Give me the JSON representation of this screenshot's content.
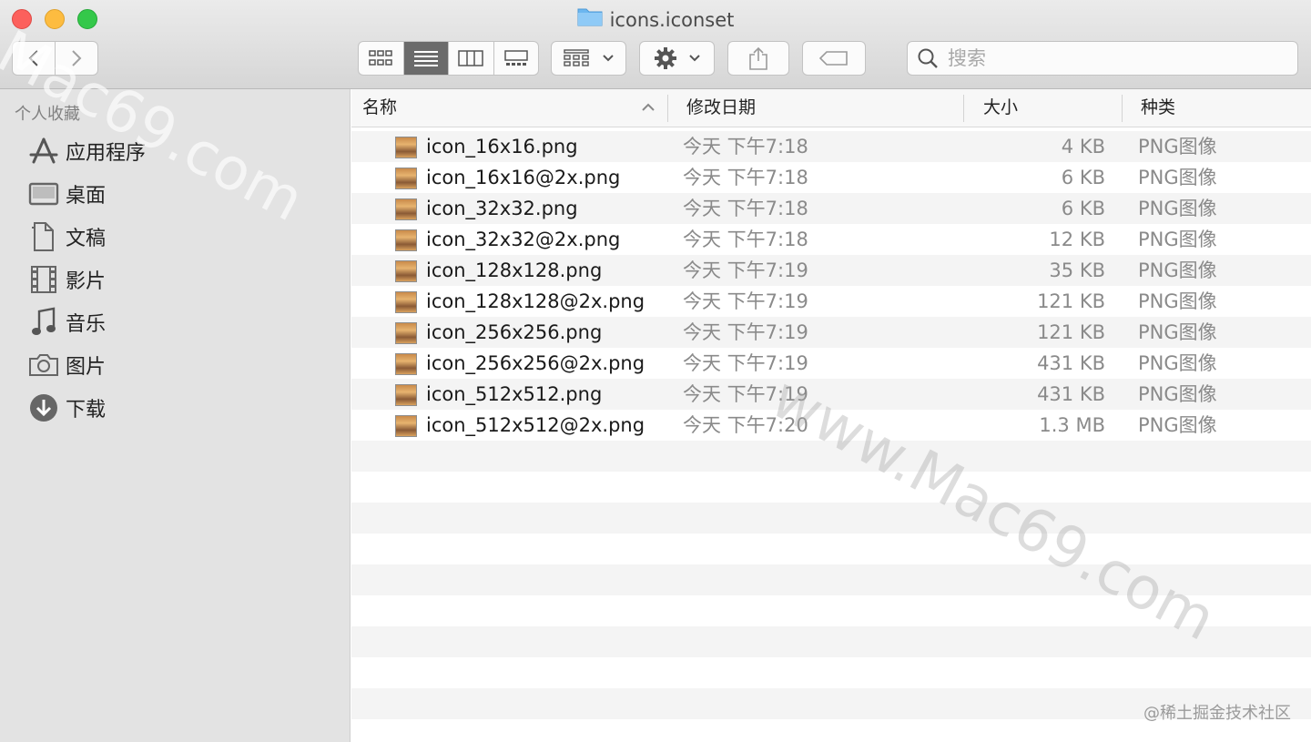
{
  "window": {
    "title": "icons.iconset"
  },
  "search": {
    "placeholder": "搜索"
  },
  "sidebar": {
    "header": "个人收藏",
    "items": [
      {
        "label": "应用程序",
        "icon": "applications-icon"
      },
      {
        "label": "桌面",
        "icon": "desktop-icon"
      },
      {
        "label": "文稿",
        "icon": "documents-icon"
      },
      {
        "label": "影片",
        "icon": "movies-icon"
      },
      {
        "label": "音乐",
        "icon": "music-icon"
      },
      {
        "label": "图片",
        "icon": "pictures-icon"
      },
      {
        "label": "下载",
        "icon": "downloads-icon"
      }
    ]
  },
  "columns": {
    "name": "名称",
    "date": "修改日期",
    "size": "大小",
    "kind": "种类"
  },
  "files": [
    {
      "name": "icon_16x16.png",
      "date": "今天 下午7:18",
      "size": "4 KB",
      "kind": "PNG图像"
    },
    {
      "name": "icon_16x16@2x.png",
      "date": "今天 下午7:18",
      "size": "6 KB",
      "kind": "PNG图像"
    },
    {
      "name": "icon_32x32.png",
      "date": "今天 下午7:18",
      "size": "6 KB",
      "kind": "PNG图像"
    },
    {
      "name": "icon_32x32@2x.png",
      "date": "今天 下午7:18",
      "size": "12 KB",
      "kind": "PNG图像"
    },
    {
      "name": "icon_128x128.png",
      "date": "今天 下午7:19",
      "size": "35 KB",
      "kind": "PNG图像"
    },
    {
      "name": "icon_128x128@2x.png",
      "date": "今天 下午7:19",
      "size": "121 KB",
      "kind": "PNG图像"
    },
    {
      "name": "icon_256x256.png",
      "date": "今天 下午7:19",
      "size": "121 KB",
      "kind": "PNG图像"
    },
    {
      "name": "icon_256x256@2x.png",
      "date": "今天 下午7:19",
      "size": "431 KB",
      "kind": "PNG图像"
    },
    {
      "name": "icon_512x512.png",
      "date": "今天 下午7:19",
      "size": "431 KB",
      "kind": "PNG图像"
    },
    {
      "name": "icon_512x512@2x.png",
      "date": "今天 下午7:20",
      "size": "1.3 MB",
      "kind": "PNG图像"
    }
  ],
  "watermarks": {
    "primary": "Mac69.com",
    "secondary": "www.Mac69.com",
    "credit": "@稀土掘金技术社区"
  },
  "colors": {
    "active_view": "#6b6b6b",
    "stripe": "#f4f4f4",
    "sidebar_bg": "#e3e3e3"
  }
}
